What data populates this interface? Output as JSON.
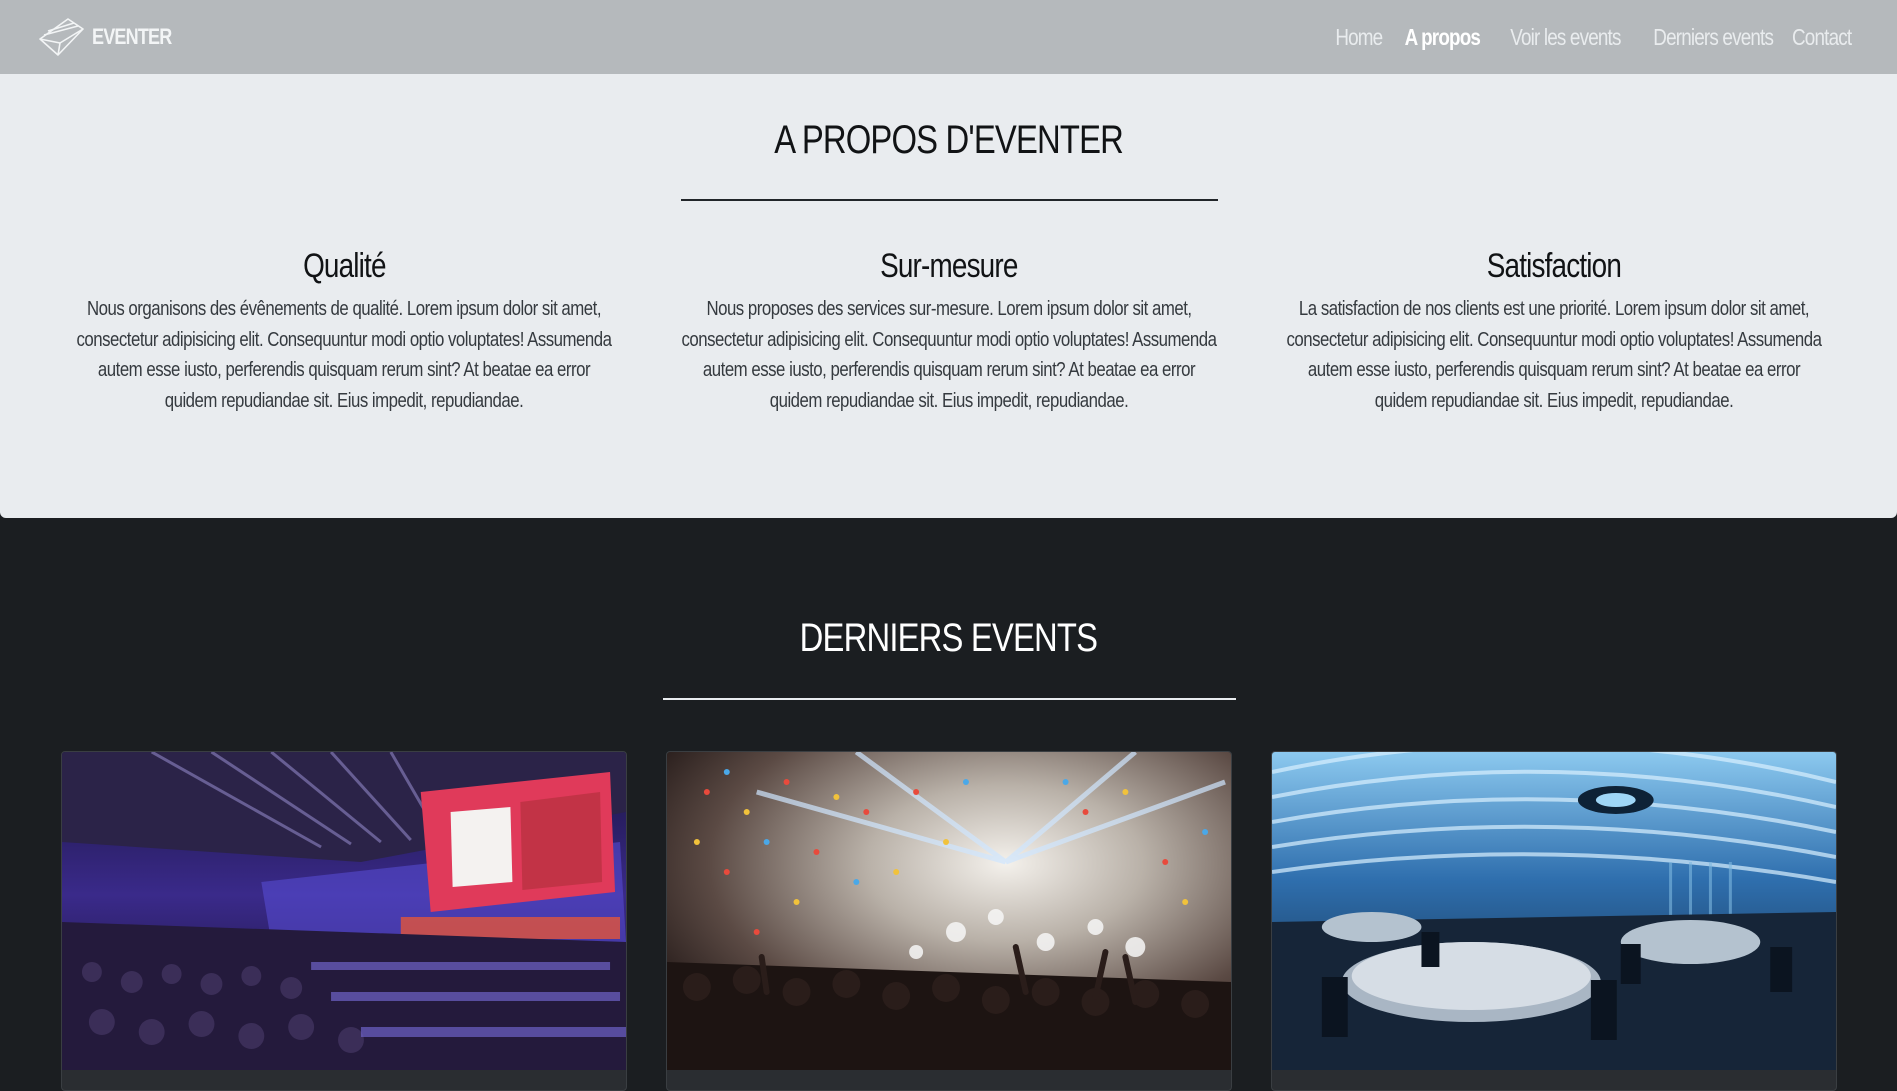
{
  "navbar": {
    "brand": "EVENTER",
    "brand_icon": "logo-mark-icon",
    "links": [
      {
        "label": "Home",
        "active": false
      },
      {
        "label": "A propos",
        "active": true
      },
      {
        "label": "Voir les events",
        "active": false
      },
      {
        "label": "Derniers events",
        "active": false
      },
      {
        "label": "Contact",
        "active": false
      }
    ]
  },
  "about": {
    "title": "A PROPOS D'EVENTER",
    "features": [
      {
        "title": "Qualité",
        "text": "Nous organisons des évênements de qualité. Lorem ipsum dolor sit amet, consectetur adipisicing elit. Consequuntur modi optio voluptates! Assumenda autem esse iusto, perferendis quisquam rerum sint? At beatae ea error quidem repudiandae sit. Eius impedit, repudiandae."
      },
      {
        "title": "Sur-mesure",
        "text": "Nous proposes des services sur-mesure. Lorem ipsum dolor sit amet, consectetur adipisicing elit. Consequuntur modi optio voluptates! Assumenda autem esse iusto, perferendis quisquam rerum sint? At beatae ea error quidem repudiandae sit. Eius impedit, repudiandae."
      },
      {
        "title": "Satisfaction",
        "text": "La satisfaction de nos clients est une priorité. Lorem ipsum dolor sit amet, consectetur adipisicing elit. Consequuntur modi optio voluptates! Assumenda autem esse iusto, perferendis quisquam rerum sint? At beatae ea error quidem repudiandae sit. Eius impedit, repudiandae."
      }
    ]
  },
  "events": {
    "title": "DERNIERS EVENTS",
    "cards": [
      {
        "image": "conference-hall-photo"
      },
      {
        "image": "concert-confetti-photo"
      },
      {
        "image": "restaurant-interior-photo"
      }
    ]
  },
  "colors": {
    "navbar_bg": "#b5b9bc",
    "about_bg": "#e9ecef",
    "events_bg": "#1b1e21",
    "nav_text": "#e9ecee",
    "nav_active": "#ffffff"
  }
}
